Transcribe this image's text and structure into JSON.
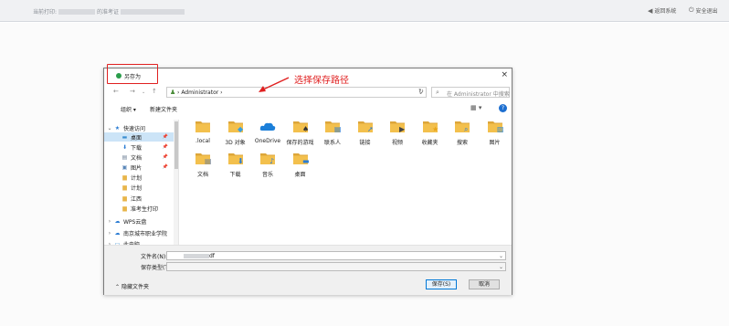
{
  "topbar": {
    "prefix": "当前打印:",
    "suffix": "的准考证",
    "back": "返回系统",
    "logout": "安全退出"
  },
  "dialog": {
    "title": "另存为",
    "close": "×",
    "path": "Administrator",
    "search_placeholder": "在 Administrator 中搜索",
    "organize": "组织 ▾",
    "new_folder": "新建文件夹",
    "help": "?"
  },
  "annotation": "选择保存路径",
  "nav": [
    {
      "label": "快速访问",
      "icon": "★",
      "color": "#2b7cd3",
      "expander": "⌄",
      "pin": false,
      "selected": false,
      "indent": 0
    },
    {
      "label": "桌面",
      "icon": "▬",
      "color": "#3b8ed0",
      "expander": "",
      "pin": true,
      "selected": true,
      "indent": 1
    },
    {
      "label": "下载",
      "icon": "⬇",
      "color": "#2b7cd3",
      "expander": "",
      "pin": true,
      "selected": false,
      "indent": 1
    },
    {
      "label": "文档",
      "icon": "▤",
      "color": "#6d7f95",
      "expander": "",
      "pin": true,
      "selected": false,
      "indent": 1
    },
    {
      "label": "图片",
      "icon": "▣",
      "color": "#5a87b8",
      "expander": "",
      "pin": true,
      "selected": false,
      "indent": 1
    },
    {
      "label": "计划",
      "icon": "▆",
      "color": "#e8b54a",
      "expander": "",
      "pin": false,
      "selected": false,
      "indent": 1
    },
    {
      "label": "计划",
      "icon": "▆",
      "color": "#e8b54a",
      "expander": "",
      "pin": false,
      "selected": false,
      "indent": 1
    },
    {
      "label": "江西",
      "icon": "▆",
      "color": "#e8b54a",
      "expander": "",
      "pin": false,
      "selected": false,
      "indent": 1
    },
    {
      "label": "准考生打印",
      "icon": "▆",
      "color": "#e8b54a",
      "expander": "",
      "pin": false,
      "selected": false,
      "indent": 1
    },
    {
      "label": "WPS云盘",
      "icon": "☁",
      "color": "#2b7cd3",
      "expander": "›",
      "pin": false,
      "selected": false,
      "indent": 0
    },
    {
      "label": "南京城市职业学院",
      "icon": "☁",
      "color": "#2b7cd3",
      "expander": "›",
      "pin": false,
      "selected": false,
      "indent": 0
    },
    {
      "label": "此电脑",
      "icon": "▭",
      "color": "#3b8ed0",
      "expander": "›",
      "pin": false,
      "selected": false,
      "indent": 0
    }
  ],
  "files": [
    {
      "name": ".local",
      "type": "folder",
      "badge": ""
    },
    {
      "name": "3D 对象",
      "type": "folder",
      "badge": "3d"
    },
    {
      "name": "OneDrive",
      "type": "onedrive",
      "badge": ""
    },
    {
      "name": "保存的游戏",
      "type": "folder",
      "badge": "game"
    },
    {
      "name": "联系人",
      "type": "folder",
      "badge": "contact"
    },
    {
      "name": "链接",
      "type": "folder",
      "badge": "link"
    },
    {
      "name": "视频",
      "type": "folder",
      "badge": "video"
    },
    {
      "name": "收藏夹",
      "type": "folder",
      "badge": "star"
    },
    {
      "name": "搜索",
      "type": "folder",
      "badge": "search"
    },
    {
      "name": "图片",
      "type": "folder",
      "badge": "picture"
    },
    {
      "name": "文档",
      "type": "folder",
      "badge": "doc"
    },
    {
      "name": "下载",
      "type": "folder",
      "badge": "download"
    },
    {
      "name": "音乐",
      "type": "folder",
      "badge": "music"
    },
    {
      "name": "桌面",
      "type": "folder",
      "badge": "desktop"
    }
  ],
  "bottom": {
    "filename_label": "文件名(N):",
    "filename_value": "df",
    "filetype_label": "保存类型(T):",
    "filetype_value": "",
    "hide_folders": "隐藏文件夹",
    "save": "保存(S)",
    "cancel": "取消"
  },
  "colors": {
    "folder": "#f3c04d",
    "folder_dark": "#dda63a",
    "accent": "#0078d7",
    "annotation": "#e02020"
  }
}
